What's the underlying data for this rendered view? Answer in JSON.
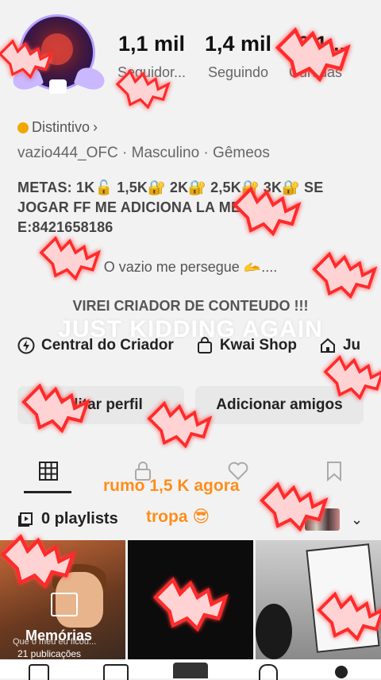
{
  "profile": {
    "stats": [
      {
        "num": "1,1 mil",
        "label": "Seguidor..."
      },
      {
        "num": "1,4 mil",
        "label": "Seguindo"
      },
      {
        "num": "10,1...",
        "label": "Curtidas"
      }
    ],
    "badge": "Distintivo",
    "meta": "vazio444_OFC · Masculino · Gêmeos",
    "bio_lines": [
      "METAS: 1K🔓 1,5K🔐 2K🔐 2,5K🔐 3K🔐 SE",
      "JOGAR FF ME ADICIONA LA MEMO",
      "E:8421658186"
    ],
    "bio_line4": "O vazio me persegue 🫴....",
    "bio_line5": "VIREI CRIADOR DE   CONTEUDO !!!",
    "watermark": "JUST KIDDING AGAIN"
  },
  "links": [
    {
      "label": "Central do Criador",
      "icon": "lightning-icon"
    },
    {
      "label": "Kwai Shop",
      "icon": "shopping-bag-icon"
    },
    {
      "label": "Ju",
      "icon": "house-icon"
    }
  ],
  "buttons": {
    "edit": "Editar perfil",
    "add_friends": "Adicionar amigos"
  },
  "overlay": {
    "line1": "rumo 1,5 K agora",
    "line2": "tropa 😎"
  },
  "playlists": {
    "label": "0 playlists"
  },
  "thumbs": {
    "memories_title": "Memórias",
    "memories_caption": "Que o meu eu ficou...",
    "memories_count": "21 publicações"
  },
  "colors": {
    "accent_orange": "#ff8c1a",
    "badge_gold": "#f0a800",
    "bat_glow": "#ff2a2a"
  }
}
